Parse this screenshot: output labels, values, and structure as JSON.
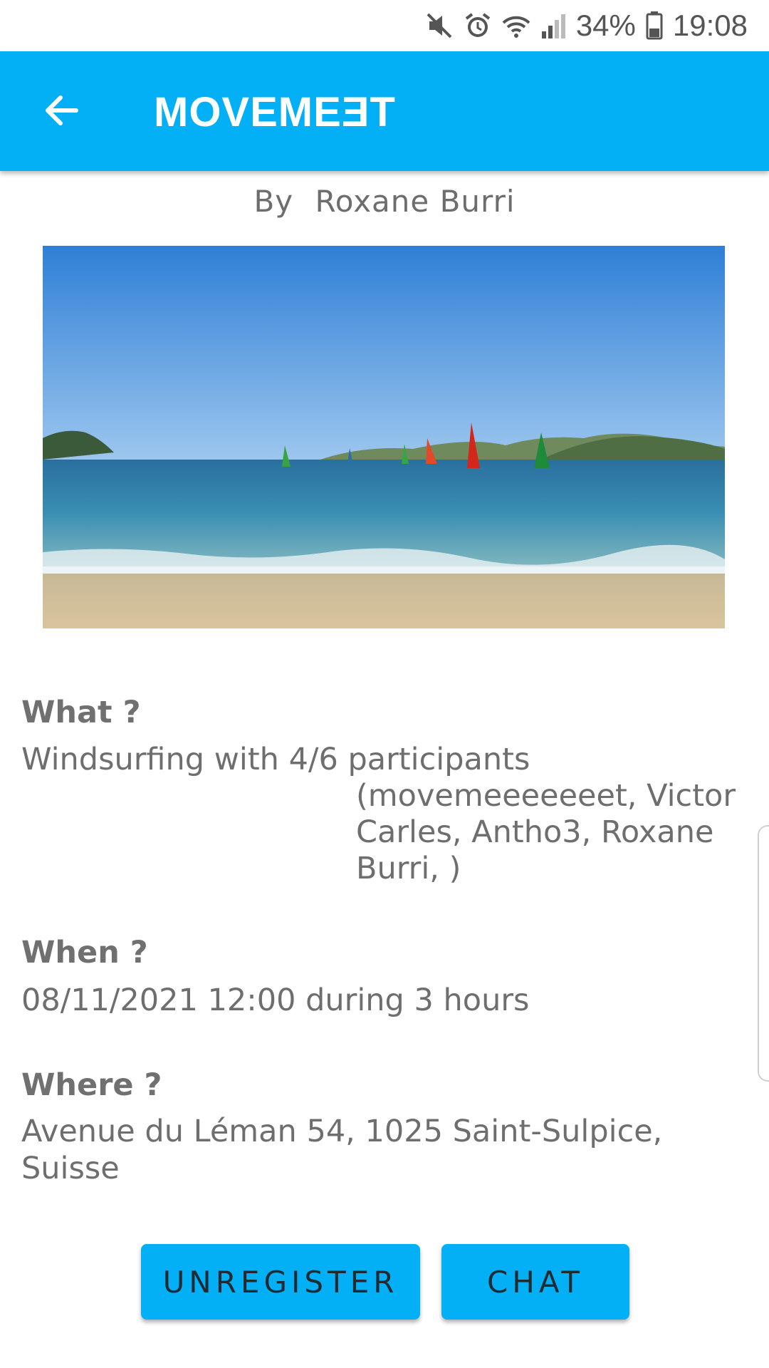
{
  "status_bar": {
    "battery": "34%",
    "time": "19:08",
    "icons": [
      "mute-icon",
      "alarm-icon",
      "wifi-icon",
      "signal-icon",
      "battery-icon"
    ]
  },
  "app_bar": {
    "title": "MOVEMEƎT",
    "back_icon": "arrow-left-icon"
  },
  "event": {
    "author_prefix": "By",
    "author_name": "Roxane Burri",
    "image_description": "windsurfers on a beach",
    "what_label": "What ?",
    "what_value": "Windsurfing with 4/6 participants",
    "participants": "(movemeeeeeeet, Victor Carles, Antho3, Roxane Burri, )",
    "when_label": "When ?",
    "when_value": "08/11/2021 12:00 during 3 hours",
    "where_label": "Where ?",
    "where_value": "Avenue du Léman 54, 1025 Saint-Sulpice, Suisse"
  },
  "actions": {
    "unregister_label": "UNREGISTER",
    "chat_label": "CHAT"
  },
  "colors": {
    "accent": "#03b0f5",
    "text": "#6e6e6e"
  }
}
